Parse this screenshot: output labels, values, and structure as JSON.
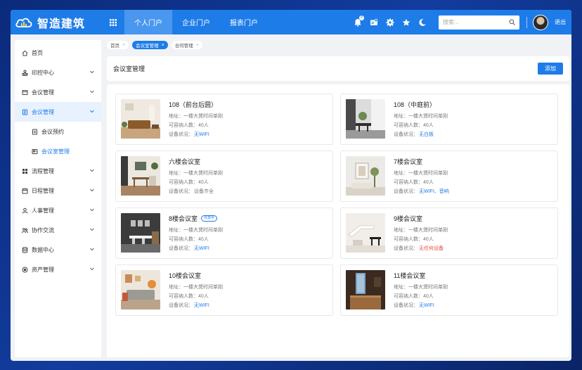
{
  "app": {
    "title": "智造建筑"
  },
  "topnav": [
    {
      "label": "个人门户",
      "active": true
    },
    {
      "label": "企业门户",
      "active": false
    },
    {
      "label": "报表门户",
      "active": false
    }
  ],
  "header_right": {
    "search_placeholder": "搜索...",
    "notification_count": "8",
    "logout": "退出"
  },
  "sidebar": {
    "items": [
      {
        "label": "首页",
        "icon": "home-icon"
      },
      {
        "label": "印控中心",
        "icon": "stamp-icon"
      },
      {
        "label": "会议管理",
        "icon": "meeting-icon"
      },
      {
        "label": "会议管理",
        "icon": "meeting-icon",
        "active": true
      },
      {
        "label": "会议预约",
        "icon": "calendar-icon",
        "sub": true
      },
      {
        "label": "会议室管理",
        "icon": "room-icon",
        "sub": true,
        "current": true
      },
      {
        "label": "流程管理",
        "icon": "flow-icon"
      },
      {
        "label": "日程管理",
        "icon": "schedule-icon"
      },
      {
        "label": "人事管理",
        "icon": "person-icon"
      },
      {
        "label": "协作交流",
        "icon": "collab-icon"
      },
      {
        "label": "数据中心",
        "icon": "data-icon"
      },
      {
        "label": "资产管理",
        "icon": "asset-icon"
      }
    ]
  },
  "tabs": [
    {
      "label": "首页",
      "active": false
    },
    {
      "label": "会议室管理",
      "active": true
    },
    {
      "label": "合同管理",
      "active": false
    }
  ],
  "page": {
    "title": "会议室管理",
    "add_label": "添加"
  },
  "rooms": [
    {
      "name": "108（前台后圆）",
      "address": "地址：一楼大煲时间单刚",
      "capacity": "可容纳人数：40人",
      "equip_prefix": "设备状况：",
      "equip": "无WIFI",
      "equip_color": "blue",
      "badge": ""
    },
    {
      "name": "108（中庭前）",
      "address": "地址：一楼大煲时间单刚",
      "capacity": "可容纳人数：40人",
      "equip_prefix": "设备状况：",
      "equip": "无白板",
      "equip_color": "blue",
      "badge": ""
    },
    {
      "name": "六楼会议室",
      "address": "地址：一楼大煲时间单刚",
      "capacity": "可容纳人数：40人",
      "equip_prefix": "设备状况：",
      "equip": "设备齐全",
      "equip_color": "gray",
      "badge": ""
    },
    {
      "name": "7楼会议室",
      "address": "地址：一楼大煲时间单刚",
      "capacity": "可容纳人数：40人",
      "equip_prefix": "设备状况：",
      "equip": "无WIFI、音响",
      "equip_color": "blue",
      "badge": ""
    },
    {
      "name": "8楼会议室",
      "address": "地址：一楼大煲时间单刚",
      "capacity": "可容纳人数：40人",
      "equip_prefix": "设备状况：",
      "equip": "无WIFI",
      "equip_color": "blue",
      "badge": "共享中"
    },
    {
      "name": "9楼会议室",
      "address": "地址：一楼大煲时间单刚",
      "capacity": "可容纳人数：40人",
      "equip_prefix": "设备状况：",
      "equip": "无任何设备",
      "equip_color": "red",
      "badge": ""
    },
    {
      "name": "10楼会议室",
      "address": "地址：一楼大煲时间单刚",
      "capacity": "可容纳人数：40人",
      "equip_prefix": "设备状况：",
      "equip": "无WIFI",
      "equip_color": "blue",
      "badge": ""
    },
    {
      "name": "11楼会议室",
      "address": "地址：一楼大煲时间单刚",
      "capacity": "可容纳人数：40人",
      "equip_prefix": "设备状况：",
      "equip": "无WIFI",
      "equip_color": "blue",
      "badge": ""
    }
  ],
  "colors": {
    "primary": "#1e7ce8",
    "danger": "#e54d42",
    "background": "#0b2a7a"
  }
}
